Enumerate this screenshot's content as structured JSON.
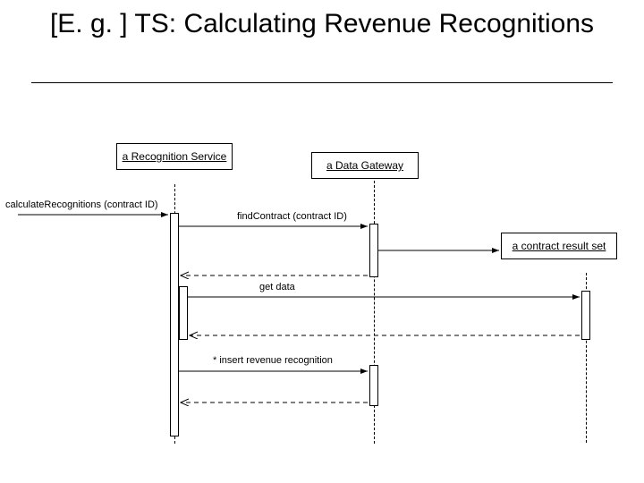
{
  "title": "[E. g. ] TS: Calculating Revenue Recognitions",
  "objects": {
    "recognition_service": "a Recognition Service",
    "data_gateway": "a Data Gateway",
    "contract_result_set": "a contract result set"
  },
  "messages": {
    "calc": "calculateRecognitions (contract ID)",
    "find": "findContract (contract ID)",
    "get_data": "get data",
    "insert": "* insert revenue recognition"
  }
}
